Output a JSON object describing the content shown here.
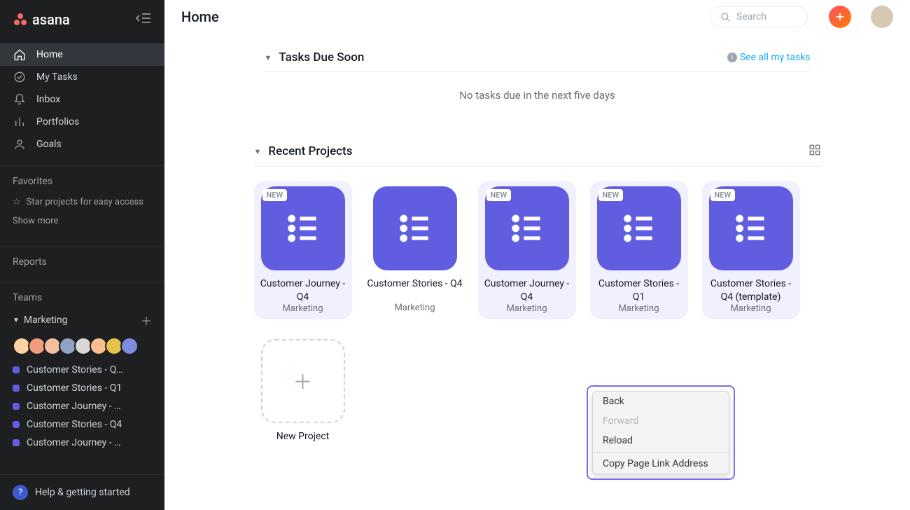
{
  "brand": "asana",
  "page_title": "Home",
  "search_placeholder": "Search",
  "nav": [
    {
      "id": "home",
      "label": "Home",
      "active": true
    },
    {
      "id": "mytasks",
      "label": "My Tasks"
    },
    {
      "id": "inbox",
      "label": "Inbox"
    },
    {
      "id": "portfolios",
      "label": "Portfolios"
    },
    {
      "id": "goals",
      "label": "Goals"
    }
  ],
  "favorites_header": "Favorites",
  "favorites_hint": "Star projects for easy access",
  "favorites_showmore": "Show more",
  "reports_header": "Reports",
  "teams_header": "Teams",
  "team": {
    "name": "Marketing",
    "projects": [
      "Customer Stories - Q…",
      "Customer Stories - Q1",
      "Customer Journey - …",
      "Customer Stories - Q4",
      "Customer Journey - …"
    ]
  },
  "help_label": "Help & getting started",
  "tasks_section": {
    "title": "Tasks Due Soon",
    "see_all": "See all my tasks",
    "empty": "No tasks due in the next five days"
  },
  "projects_section": {
    "title": "Recent Projects",
    "tiles": [
      {
        "name": "Customer Journey - Q4",
        "team": "Marketing",
        "new": true
      },
      {
        "name": "Customer Stories - Q4",
        "team": "Marketing",
        "new": false
      },
      {
        "name": "Customer Journey - Q4",
        "team": "Marketing",
        "new": true
      },
      {
        "name": "Customer Stories - Q1",
        "team": "Marketing",
        "new": true
      },
      {
        "name": "Customer Stories - Q4 (template)",
        "team": "Marketing",
        "new": true
      }
    ],
    "new_badge": "NEW",
    "new_project_label": "New Project"
  },
  "context_menu": {
    "items": [
      {
        "label": "Back",
        "enabled": true
      },
      {
        "label": "Forward",
        "enabled": false
      },
      {
        "label": "Reload",
        "enabled": true
      }
    ],
    "sep_item": {
      "label": "Copy Page Link Address",
      "enabled": true
    }
  }
}
